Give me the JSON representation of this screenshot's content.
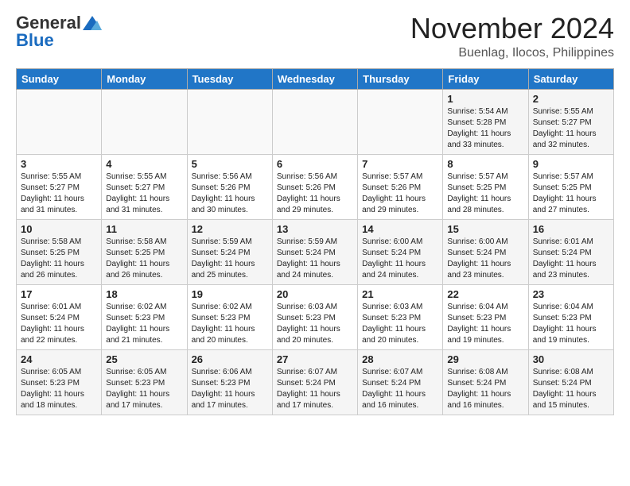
{
  "logo": {
    "general": "General",
    "blue": "Blue"
  },
  "header": {
    "month": "November 2024",
    "location": "Buenlag, Ilocos, Philippines"
  },
  "weekdays": [
    "Sunday",
    "Monday",
    "Tuesday",
    "Wednesday",
    "Thursday",
    "Friday",
    "Saturday"
  ],
  "weeks": [
    [
      {
        "day": "",
        "info": ""
      },
      {
        "day": "",
        "info": ""
      },
      {
        "day": "",
        "info": ""
      },
      {
        "day": "",
        "info": ""
      },
      {
        "day": "",
        "info": ""
      },
      {
        "day": "1",
        "info": "Sunrise: 5:54 AM\nSunset: 5:28 PM\nDaylight: 11 hours\nand 33 minutes."
      },
      {
        "day": "2",
        "info": "Sunrise: 5:55 AM\nSunset: 5:27 PM\nDaylight: 11 hours\nand 32 minutes."
      }
    ],
    [
      {
        "day": "3",
        "info": "Sunrise: 5:55 AM\nSunset: 5:27 PM\nDaylight: 11 hours\nand 31 minutes."
      },
      {
        "day": "4",
        "info": "Sunrise: 5:55 AM\nSunset: 5:27 PM\nDaylight: 11 hours\nand 31 minutes."
      },
      {
        "day": "5",
        "info": "Sunrise: 5:56 AM\nSunset: 5:26 PM\nDaylight: 11 hours\nand 30 minutes."
      },
      {
        "day": "6",
        "info": "Sunrise: 5:56 AM\nSunset: 5:26 PM\nDaylight: 11 hours\nand 29 minutes."
      },
      {
        "day": "7",
        "info": "Sunrise: 5:57 AM\nSunset: 5:26 PM\nDaylight: 11 hours\nand 29 minutes."
      },
      {
        "day": "8",
        "info": "Sunrise: 5:57 AM\nSunset: 5:25 PM\nDaylight: 11 hours\nand 28 minutes."
      },
      {
        "day": "9",
        "info": "Sunrise: 5:57 AM\nSunset: 5:25 PM\nDaylight: 11 hours\nand 27 minutes."
      }
    ],
    [
      {
        "day": "10",
        "info": "Sunrise: 5:58 AM\nSunset: 5:25 PM\nDaylight: 11 hours\nand 26 minutes."
      },
      {
        "day": "11",
        "info": "Sunrise: 5:58 AM\nSunset: 5:25 PM\nDaylight: 11 hours\nand 26 minutes."
      },
      {
        "day": "12",
        "info": "Sunrise: 5:59 AM\nSunset: 5:24 PM\nDaylight: 11 hours\nand 25 minutes."
      },
      {
        "day": "13",
        "info": "Sunrise: 5:59 AM\nSunset: 5:24 PM\nDaylight: 11 hours\nand 24 minutes."
      },
      {
        "day": "14",
        "info": "Sunrise: 6:00 AM\nSunset: 5:24 PM\nDaylight: 11 hours\nand 24 minutes."
      },
      {
        "day": "15",
        "info": "Sunrise: 6:00 AM\nSunset: 5:24 PM\nDaylight: 11 hours\nand 23 minutes."
      },
      {
        "day": "16",
        "info": "Sunrise: 6:01 AM\nSunset: 5:24 PM\nDaylight: 11 hours\nand 23 minutes."
      }
    ],
    [
      {
        "day": "17",
        "info": "Sunrise: 6:01 AM\nSunset: 5:24 PM\nDaylight: 11 hours\nand 22 minutes."
      },
      {
        "day": "18",
        "info": "Sunrise: 6:02 AM\nSunset: 5:23 PM\nDaylight: 11 hours\nand 21 minutes."
      },
      {
        "day": "19",
        "info": "Sunrise: 6:02 AM\nSunset: 5:23 PM\nDaylight: 11 hours\nand 20 minutes."
      },
      {
        "day": "20",
        "info": "Sunrise: 6:03 AM\nSunset: 5:23 PM\nDaylight: 11 hours\nand 20 minutes."
      },
      {
        "day": "21",
        "info": "Sunrise: 6:03 AM\nSunset: 5:23 PM\nDaylight: 11 hours\nand 20 minutes."
      },
      {
        "day": "22",
        "info": "Sunrise: 6:04 AM\nSunset: 5:23 PM\nDaylight: 11 hours\nand 19 minutes."
      },
      {
        "day": "23",
        "info": "Sunrise: 6:04 AM\nSunset: 5:23 PM\nDaylight: 11 hours\nand 19 minutes."
      }
    ],
    [
      {
        "day": "24",
        "info": "Sunrise: 6:05 AM\nSunset: 5:23 PM\nDaylight: 11 hours\nand 18 minutes."
      },
      {
        "day": "25",
        "info": "Sunrise: 6:05 AM\nSunset: 5:23 PM\nDaylight: 11 hours\nand 17 minutes."
      },
      {
        "day": "26",
        "info": "Sunrise: 6:06 AM\nSunset: 5:23 PM\nDaylight: 11 hours\nand 17 minutes."
      },
      {
        "day": "27",
        "info": "Sunrise: 6:07 AM\nSunset: 5:24 PM\nDaylight: 11 hours\nand 17 minutes."
      },
      {
        "day": "28",
        "info": "Sunrise: 6:07 AM\nSunset: 5:24 PM\nDaylight: 11 hours\nand 16 minutes."
      },
      {
        "day": "29",
        "info": "Sunrise: 6:08 AM\nSunset: 5:24 PM\nDaylight: 11 hours\nand 16 minutes."
      },
      {
        "day": "30",
        "info": "Sunrise: 6:08 AM\nSunset: 5:24 PM\nDaylight: 11 hours\nand 15 minutes."
      }
    ]
  ]
}
